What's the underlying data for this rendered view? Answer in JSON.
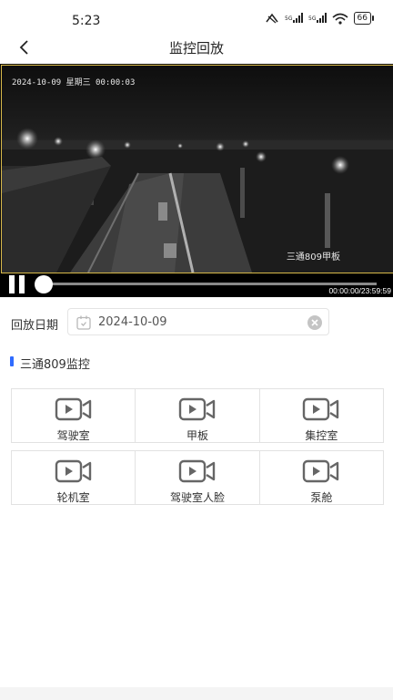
{
  "status_bar": {
    "time": "5:23",
    "signal1": "᷊ᵢıll",
    "battery": "66"
  },
  "nav": {
    "title": "监控回放"
  },
  "video": {
    "osd_timestamp": "2024-10-09 星期三 00:00:03",
    "osd_channel": "三通809甲板",
    "time_readout": "00:00:00/23:59:59",
    "progress": 0
  },
  "date_filter": {
    "label": "回放日期",
    "value": "2024-10-09"
  },
  "section": {
    "title": "三通809监控"
  },
  "cameras": [
    [
      {
        "label": "驾驶室"
      },
      {
        "label": "甲板"
      },
      {
        "label": "集控室"
      }
    ],
    [
      {
        "label": "轮机室"
      },
      {
        "label": "驾驶室人脸"
      },
      {
        "label": "泵舱"
      }
    ]
  ],
  "colors": {
    "accent": "#2f6bff",
    "frame_border": "#d8b94a"
  }
}
